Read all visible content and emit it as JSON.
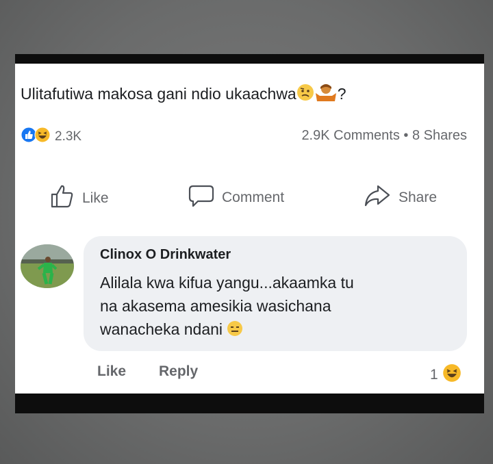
{
  "post": {
    "text": "Ulitafutiwa makosa gani ndio ukaachwa",
    "question_mark": "?",
    "emojis": [
      "confused-face-icon",
      "person-shrugging-icon"
    ]
  },
  "stats": {
    "reaction_icons": [
      "like-reaction-icon",
      "haha-reaction-icon"
    ],
    "reaction_count": "2.3K",
    "comments_shares": "2.9K Comments • 8 Shares"
  },
  "actions": {
    "like": "Like",
    "comment": "Comment",
    "share": "Share"
  },
  "comment": {
    "author": "Clinox O Drinkwater",
    "lines": [
      "Alilala kwa kifua yangu...akaamka tu",
      "na akasema amesikia wasichana",
      "wanacheka ndani"
    ],
    "trailing_emoji": "expressionless-face-icon",
    "like_label": "Like",
    "reply_label": "Reply",
    "reaction_count": "1",
    "reaction_icon": "haha-reaction-icon"
  },
  "colors": {
    "background": "#6a6b6b",
    "card": "#ffffff",
    "bar": "#0d0d0d",
    "bubble": "#eef0f3",
    "like_blue": "#1877f2",
    "haha_yellow": "#f7b928",
    "muted_text": "#65676b"
  }
}
